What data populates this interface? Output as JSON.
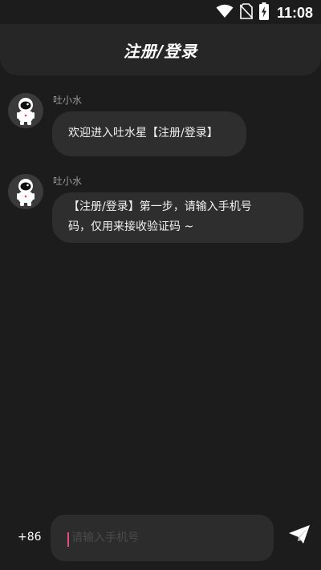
{
  "status_bar": {
    "time": "11:08",
    "icons": [
      "wifi-icon",
      "no-sim-icon",
      "battery-charging-icon"
    ]
  },
  "header": {
    "title": "注册/登录"
  },
  "messages": [
    {
      "sender": "吐小水",
      "avatar_icon": "astronaut-avatar-icon",
      "line1": "欢迎进入吐水星【注册/登录】",
      "line2": ""
    },
    {
      "sender": "吐小水",
      "avatar_icon": "astronaut-avatar-icon",
      "line1": "【注册/登录】第一步，请输入手机号",
      "line2": "码，仅用来接收验证码 ~"
    }
  ],
  "composer": {
    "country_code": "+86",
    "phone_placeholder": "请输入手机号",
    "phone_value": "",
    "send_icon": "paper-plane-icon"
  },
  "colors": {
    "background": "#1c1c1c",
    "header": "#262626",
    "bubble": "#2e2e2e",
    "caret": "#e0507a"
  }
}
